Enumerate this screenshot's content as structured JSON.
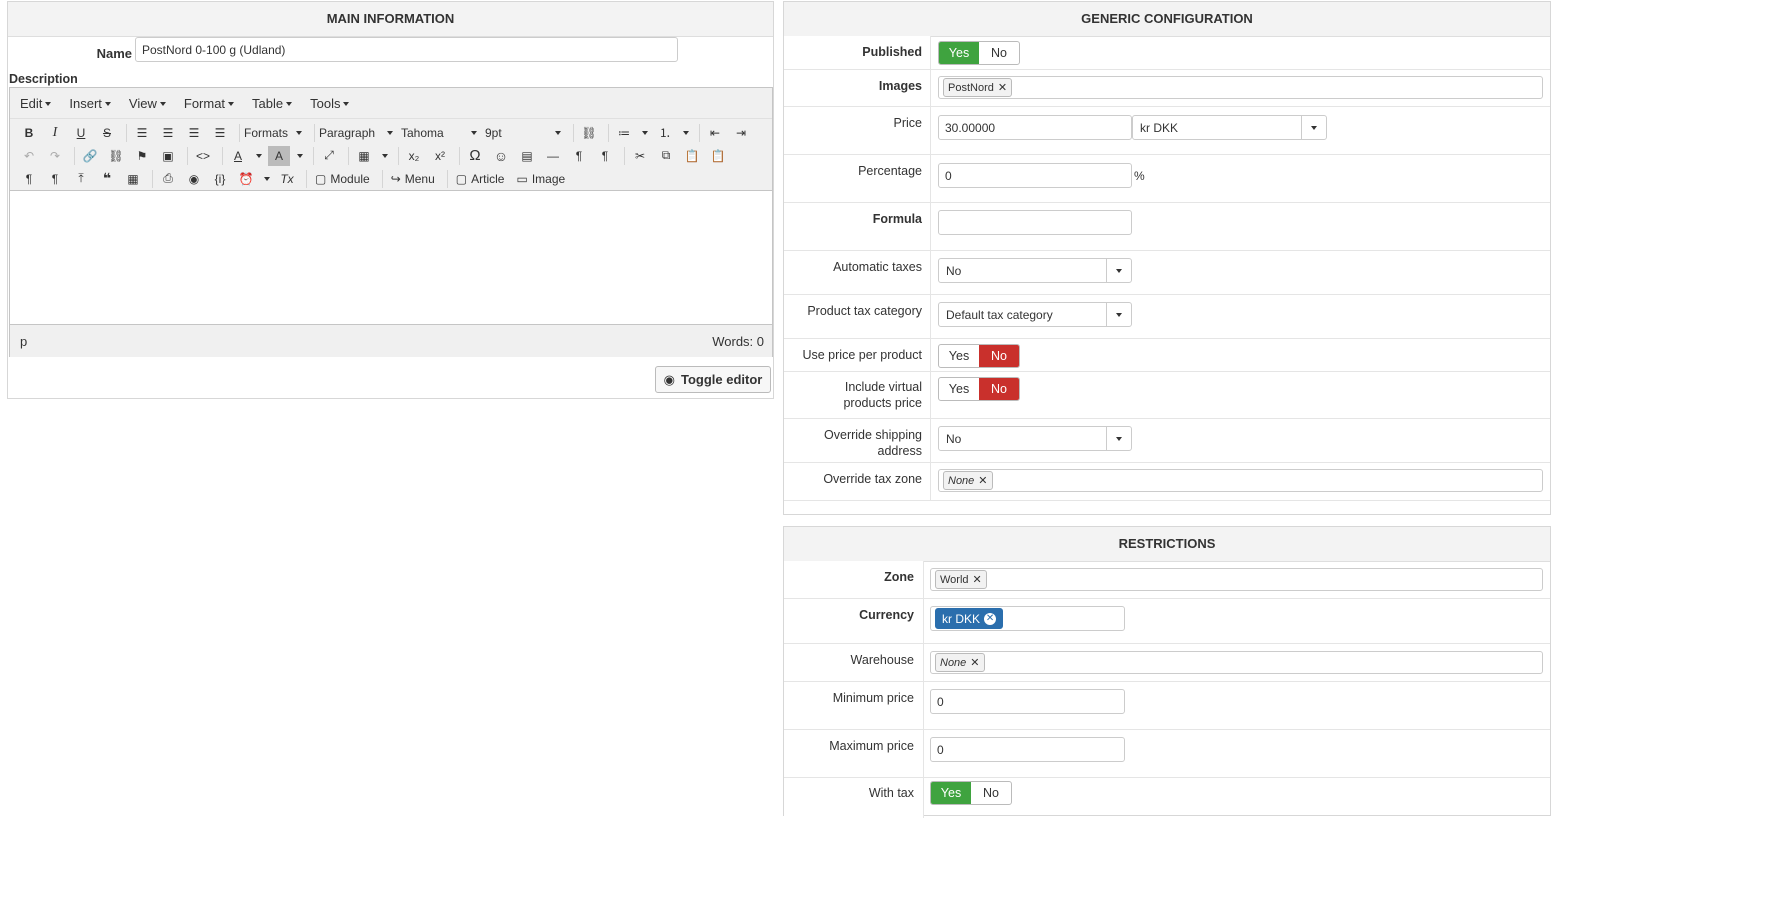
{
  "main": {
    "title": "MAIN INFORMATION",
    "name_label": "Name",
    "name_value": "PostNord 0-100 g (Udland)",
    "description_label": "Description",
    "menu": [
      "Edit",
      "Insert",
      "View",
      "Format",
      "Table",
      "Tools"
    ],
    "toolbar": {
      "formats": "Formats",
      "paragraph": "Paragraph",
      "font": "Tahoma",
      "size": "9pt",
      "module": "Module",
      "menu": "Menu",
      "article": "Article",
      "image": "Image"
    },
    "status_path": "p",
    "word_count": "Words: 0",
    "toggle_editor": "Toggle editor"
  },
  "generic": {
    "title": "GENERIC CONFIGURATION",
    "published_label": "Published",
    "yes": "Yes",
    "no": "No",
    "images_label": "Images",
    "images_tag": "PostNord",
    "price_label": "Price",
    "price_value": "30.00000",
    "currency_value": "kr DKK",
    "percentage_label": "Percentage",
    "percentage_value": "0",
    "percent_sign": "%",
    "formula_label": "Formula",
    "formula_value": "",
    "automatic_taxes_label": "Automatic taxes",
    "automatic_taxes_value": "No",
    "product_tax_label": "Product tax category",
    "product_tax_value": "Default tax category",
    "use_price_label": "Use price per product",
    "include_virtual_label1": "Include virtual",
    "include_virtual_label2": "products price",
    "override_shipping_label": "Override shipping address",
    "override_shipping_value": "No",
    "override_tax_label": "Override tax zone",
    "override_tax_tag": "None"
  },
  "restrictions": {
    "title": "RESTRICTIONS",
    "zone_label": "Zone",
    "zone_tag": "World",
    "currency_label": "Currency",
    "currency_tag": "kr DKK",
    "warehouse_label": "Warehouse",
    "warehouse_tag": "None",
    "min_price_label": "Minimum price",
    "min_price_value": "0",
    "max_price_label": "Maximum price",
    "max_price_value": "0",
    "with_tax_label": "With tax",
    "yes": "Yes",
    "no": "No"
  }
}
